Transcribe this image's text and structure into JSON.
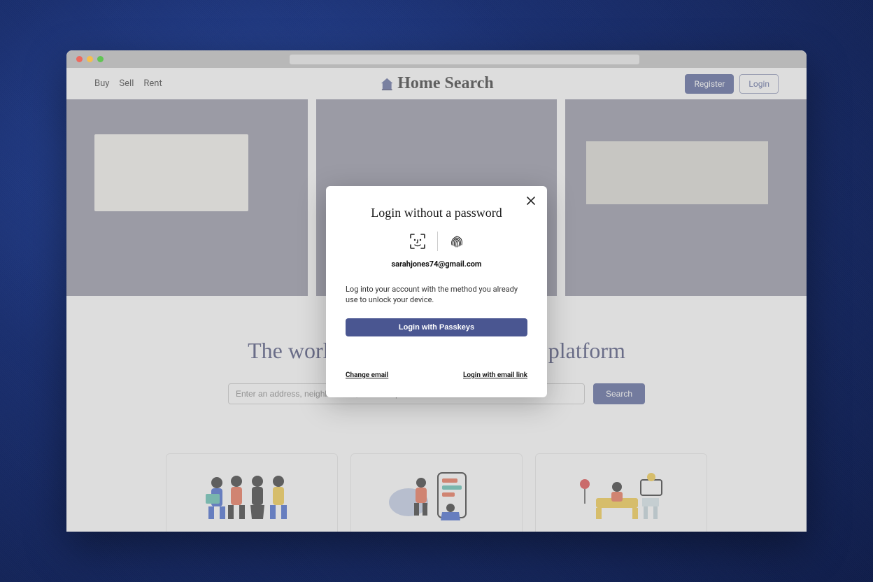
{
  "nav": {
    "buy": "Buy",
    "sell": "Sell",
    "rent": "Rent",
    "brand": "Home Search",
    "register": "Register",
    "login": "Login"
  },
  "tagline": "The world's leading home search platform",
  "search": {
    "placeholder": "Enter an address, neighborhood, area or zip code",
    "button": "Search"
  },
  "modal": {
    "title": "Login without a password",
    "email": "sarahjones74@gmail.com",
    "desc": "Log into your account with the method you already use to unlock your device.",
    "passkey_button": "Login with Passkeys",
    "change_email": "Change email",
    "email_link": "Login with email link"
  }
}
